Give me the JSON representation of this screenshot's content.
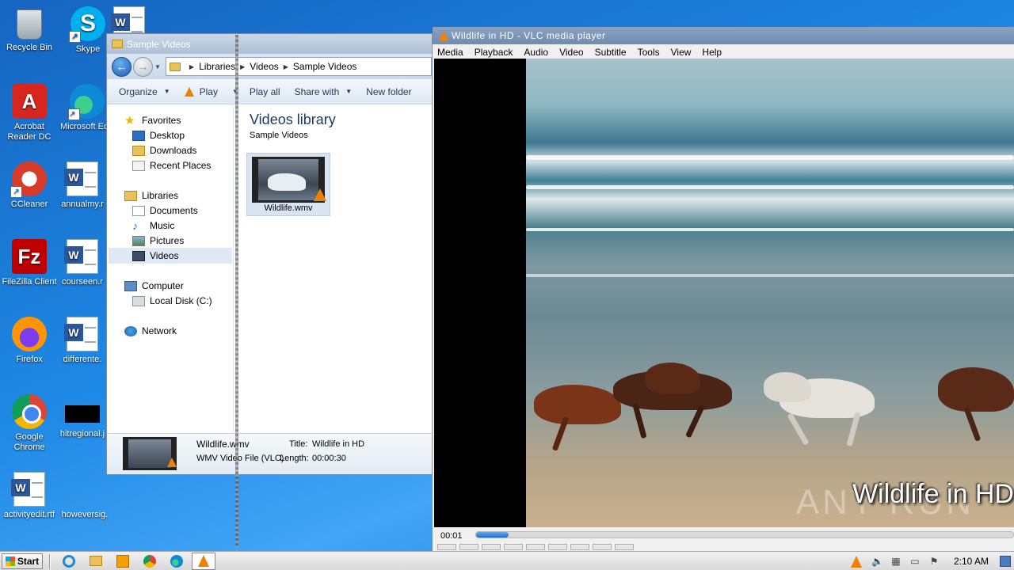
{
  "desktop": {
    "icons": [
      {
        "label": "Recycle Bin",
        "icon": "recycle-bin-icon"
      },
      {
        "label": "Skype",
        "icon": "skype-icon"
      },
      {
        "label": "Acrobat Reader DC",
        "icon": "acrobat-icon"
      },
      {
        "label": "Microsoft Ed",
        "icon": "edge-icon"
      },
      {
        "label": "CCleaner",
        "icon": "ccleaner-icon"
      },
      {
        "label": "annualmy.r",
        "icon": "word-doc-icon"
      },
      {
        "label": "FileZilla Client",
        "icon": "filezilla-icon"
      },
      {
        "label": "courseen.r",
        "icon": "word-doc-icon"
      },
      {
        "label": "Firefox",
        "icon": "firefox-icon"
      },
      {
        "label": "differente.",
        "icon": "word-doc-icon"
      },
      {
        "label": "Google Chrome",
        "icon": "chrome-icon"
      },
      {
        "label": "hitregional.j",
        "icon": "image-icon"
      },
      {
        "label": "activityedit.rtf",
        "icon": "word-doc-icon"
      },
      {
        "label": "howeversig.",
        "icon": "blank-file-icon"
      }
    ]
  },
  "explorer": {
    "title": "Sample Videos",
    "breadcrumb": [
      "Libraries",
      "Videos",
      "Sample Videos"
    ],
    "toolbar": {
      "organize": "Organize",
      "play": "Play",
      "play_all": "Play all",
      "share_with": "Share with",
      "new_folder": "New folder"
    },
    "nav": {
      "favorites": "Favorites",
      "desktop": "Desktop",
      "downloads": "Downloads",
      "recent_places": "Recent Places",
      "libraries": "Libraries",
      "documents": "Documents",
      "music": "Music",
      "pictures": "Pictures",
      "videos": "Videos",
      "computer": "Computer",
      "local_disk": "Local Disk (C:)",
      "network": "Network"
    },
    "main": {
      "library_title": "Videos library",
      "library_sub": "Sample Videos",
      "file_name": "Wildlife.wmv"
    },
    "details": {
      "name": "Wildlife.wmv",
      "type": "WMV Video File (VLC)",
      "title_label": "Title:",
      "title_value": "Wildlife in HD",
      "length_label": "Length:",
      "length_value": "00:00:30"
    }
  },
  "vlc": {
    "title": "Wildlife in HD - VLC media player",
    "menu": [
      "Media",
      "Playback",
      "Audio",
      "Video",
      "Subtitle",
      "Tools",
      "View",
      "Help"
    ],
    "subtitle_overlay": "Wildlife in HD",
    "watermark": "ANY RUN",
    "time": "00:01",
    "progress": 0.06
  },
  "taskbar": {
    "start_label": "Start",
    "clock": "2:10 AM"
  }
}
